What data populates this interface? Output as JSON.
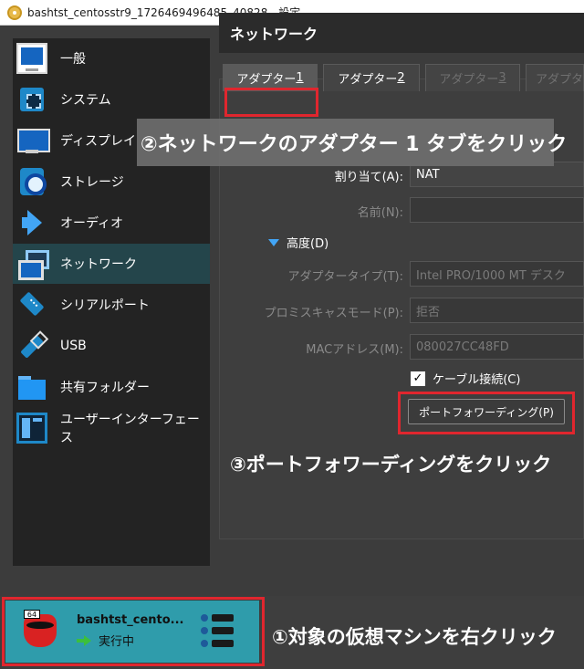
{
  "window": {
    "title": "bashtst_centosstr9_1726469496485_40828 - 設定"
  },
  "sidebar": {
    "items": [
      {
        "label": "一般",
        "icon": "monitor-icon"
      },
      {
        "label": "システム",
        "icon": "chip-icon"
      },
      {
        "label": "ディスプレイ",
        "icon": "display-icon"
      },
      {
        "label": "ストレージ",
        "icon": "storage-icon"
      },
      {
        "label": "オーディオ",
        "icon": "audio-icon"
      },
      {
        "label": "ネットワーク",
        "icon": "network-icon",
        "active": true
      },
      {
        "label": "シリアルポート",
        "icon": "serial-port-icon"
      },
      {
        "label": "USB",
        "icon": "usb-icon"
      },
      {
        "label": "共有フォルダー",
        "icon": "shared-folder-icon"
      },
      {
        "label": "ユーザーインターフェース",
        "icon": "user-interface-icon"
      }
    ]
  },
  "page": {
    "title": "ネットワーク"
  },
  "tabs": [
    {
      "label": "アダプター ",
      "key": "1",
      "state": "active"
    },
    {
      "label": "アダプター ",
      "key": "2",
      "state": "enabled"
    },
    {
      "label": "アダプター ",
      "key": "3",
      "state": "disabled"
    },
    {
      "label": "アダプタ",
      "key": "",
      "state": "disabled"
    }
  ],
  "form": {
    "attached_label": "割り当て(A):",
    "attached_value": "NAT",
    "name_label": "名前(N):",
    "name_value": "",
    "advanced_label": "高度(D)",
    "adapter_type_label": "アダプタータイプ(T):",
    "adapter_type_value": "Intel PRO/1000 MT デスク",
    "promiscuous_label": "プロミスキャスモード(P):",
    "promiscuous_value": "拒否",
    "mac_label": "MACアドレス(M):",
    "mac_value": "080027CC48FD",
    "cable_label": "ケーブル接続(C)",
    "cable_checked": "✓",
    "port_forwarding_label": "ポートフォワーディング(P)"
  },
  "annotations": {
    "step1": "①対象の仮想マシンを右クリック",
    "step2": "②ネットワークのアダプター 1 タブをクリック",
    "step3": "③ポートフォワーディングをクリック"
  },
  "vm": {
    "badge": "64",
    "name": "bashtst_cento...",
    "state": "実行中"
  },
  "colors": {
    "accent_selected": "#24454b",
    "vm_item_bg": "#2f9cab",
    "highlight_border": "#e0262e"
  }
}
